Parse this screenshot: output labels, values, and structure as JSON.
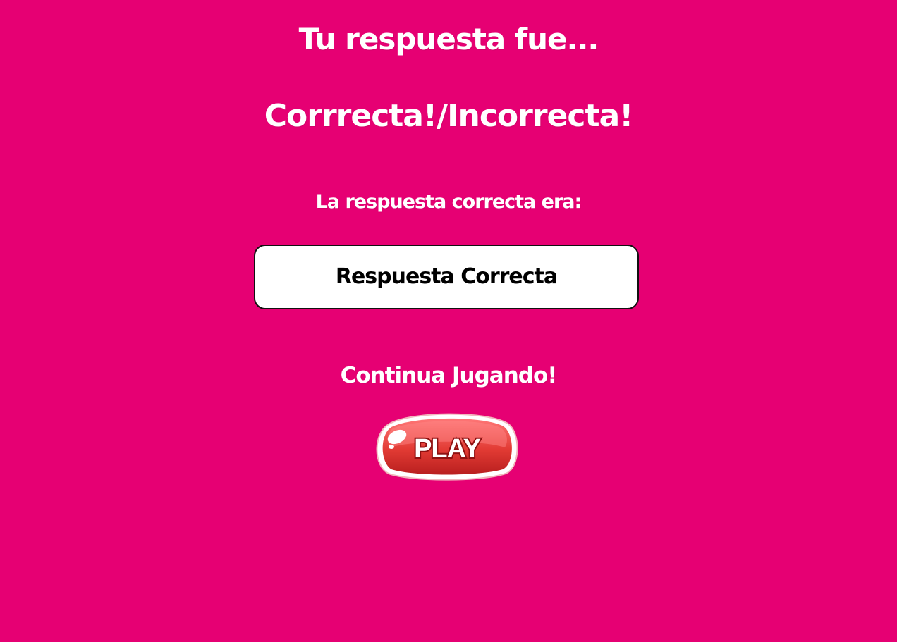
{
  "screen": {
    "title": "Tu respuesta fue...",
    "result": "Corrrecta!/Incorrecta!",
    "answer_label": "La respuesta correcta era:",
    "correct_answer": "Respuesta Correcta",
    "continue_text": "Continua Jugando!",
    "play_button_label": "PLAY"
  },
  "colors": {
    "background": "#e60073",
    "text": "#ffffff",
    "answer_box": "#ffffff",
    "play_button": "#d82f2a"
  },
  "icons": {
    "play_button": "play-button-icon"
  }
}
